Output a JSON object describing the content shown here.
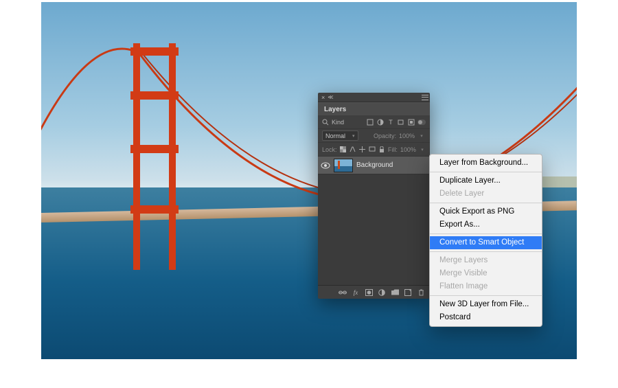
{
  "panel": {
    "title": "Layers",
    "filter_label": "Kind",
    "blend_mode": "Normal",
    "opacity_label": "Opacity:",
    "opacity_value": "100%",
    "lock_label": "Lock:",
    "fill_label": "Fill:",
    "fill_value": "100%",
    "layer": {
      "name": "Background"
    }
  },
  "menu": {
    "items": [
      {
        "label": "Layer from Background...",
        "enabled": true
      },
      {
        "sep": true
      },
      {
        "label": "Duplicate Layer...",
        "enabled": true
      },
      {
        "label": "Delete Layer",
        "enabled": false
      },
      {
        "sep": true
      },
      {
        "label": "Quick Export as PNG",
        "enabled": true
      },
      {
        "label": "Export As...",
        "enabled": true
      },
      {
        "sep": true
      },
      {
        "label": "Convert to Smart Object",
        "enabled": true,
        "highlight": true
      },
      {
        "sep": true
      },
      {
        "label": "Merge Layers",
        "enabled": false
      },
      {
        "label": "Merge Visible",
        "enabled": false
      },
      {
        "label": "Flatten Image",
        "enabled": false
      },
      {
        "sep": true
      },
      {
        "label": "New 3D Layer from File...",
        "enabled": true
      },
      {
        "label": "Postcard",
        "enabled": true
      }
    ]
  }
}
